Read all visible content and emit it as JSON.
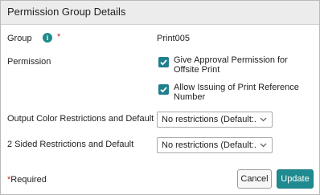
{
  "dialog": {
    "title": "Permission Group Details"
  },
  "group": {
    "label": "Group",
    "info_icon": "i",
    "required_mark": "*",
    "value": "Print005"
  },
  "permission": {
    "label": "Permission",
    "options": [
      {
        "label": "Give Approval Permission for Offsite Print",
        "checked": true
      },
      {
        "label": "Allow Issuing of Print Reference Number",
        "checked": true
      }
    ]
  },
  "output_color": {
    "label": "Output Color Restrictions and Default",
    "selected": "No restrictions (Default:..."
  },
  "two_sided": {
    "label": "2 Sided Restrictions and Default",
    "selected": "No restrictions (Default:..."
  },
  "footer": {
    "required_star": "*",
    "required_text": "Required",
    "cancel_label": "Cancel",
    "update_label": "Update"
  },
  "colors": {
    "accent": "#1f8a8f",
    "required": "#cc1f1f",
    "header_bg": "#ececec"
  }
}
